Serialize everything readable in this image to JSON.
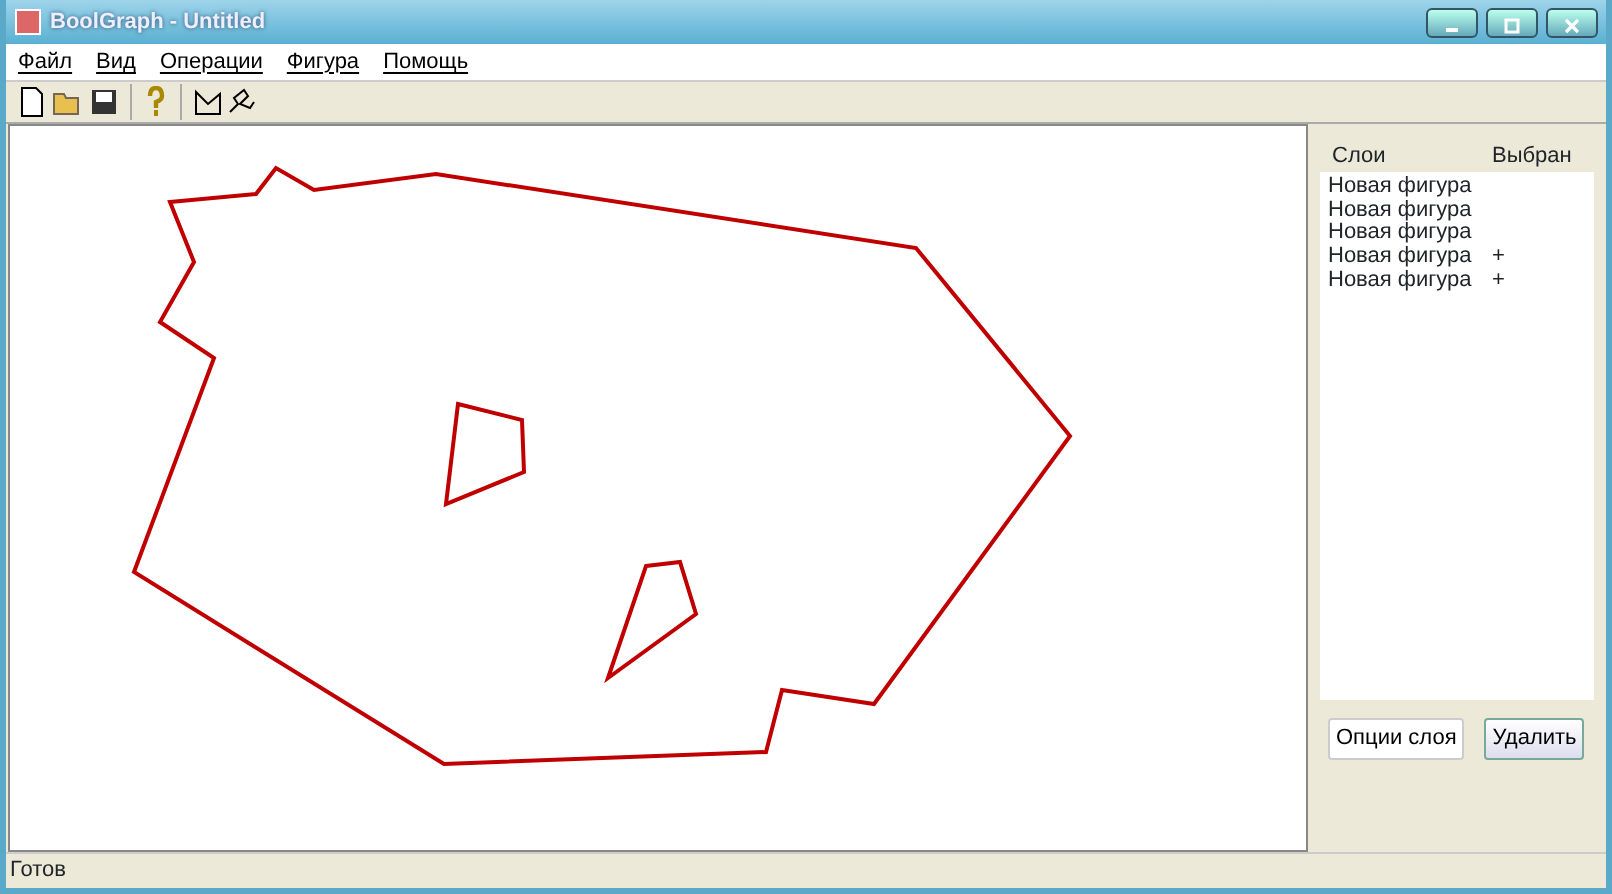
{
  "window": {
    "title": "BoolGraph - Untitled"
  },
  "menu": [
    "Файл",
    "Вид",
    "Операции",
    "Фигура",
    "Помощь"
  ],
  "layers_panel": {
    "columns": [
      "Слои",
      "Выбран"
    ],
    "layers": [
      {
        "name": "Новая фигура"
      },
      {
        "name": "Новая фигура"
      },
      {
        "name": "Новая фигура"
      },
      {
        "name": "Новая фигура",
        "mark": "+"
      },
      {
        "name": "Новая фигура",
        "mark": "+"
      }
    ],
    "buttons": [
      "Опции слоя",
      "Удалить"
    ]
  },
  "status_bar": "Готов"
}
